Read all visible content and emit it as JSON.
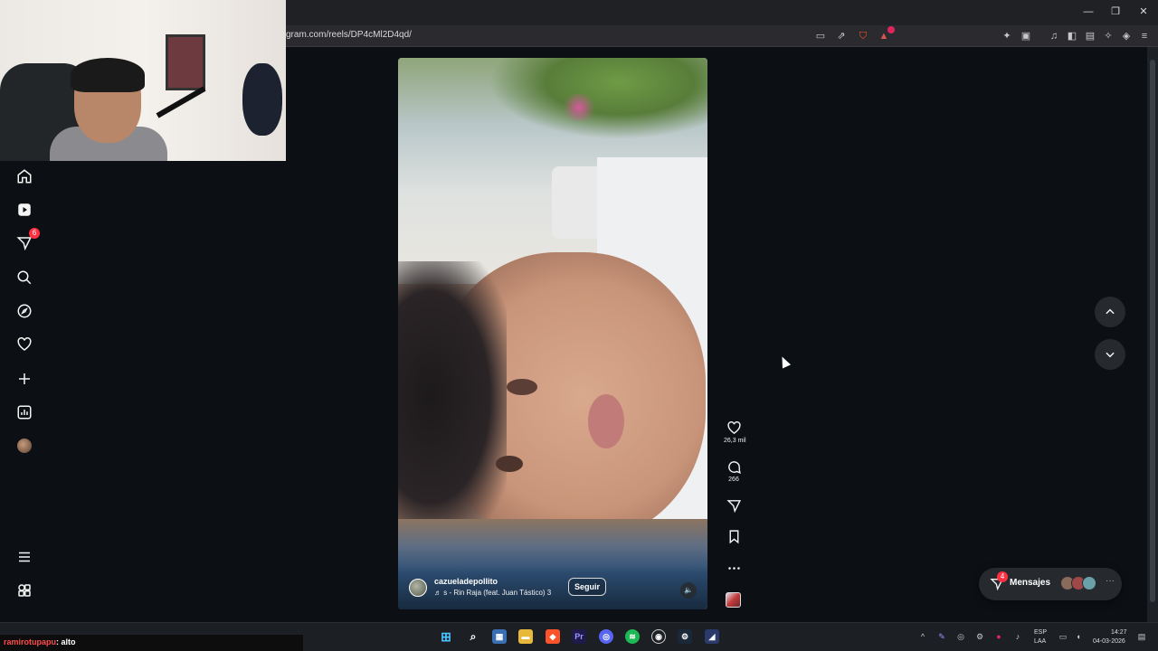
{
  "browser": {
    "url": "gram.com/reels/DP4cMl2D4qd/"
  },
  "nav": {
    "notifications_badge": "6"
  },
  "reel": {
    "username": "cazueladepollito",
    "music": "♬ ​​s - Rin Raja (feat. Juan Tástico)  3",
    "follow_label": "Seguir",
    "likes": "26,3 mil",
    "comments": "266"
  },
  "messages": {
    "label": "Mensajes",
    "badge": "4"
  },
  "chat": {
    "user": "ramirotupapu",
    "text": ": alto"
  },
  "tray": {
    "lang_line1": "ESP",
    "lang_line2": "LAA",
    "time": "14:27",
    "date": "04-03-2026"
  },
  "colors": {
    "brave": "#fb542b",
    "instagram_badge": "#ff3040",
    "background": "#0c1014"
  }
}
